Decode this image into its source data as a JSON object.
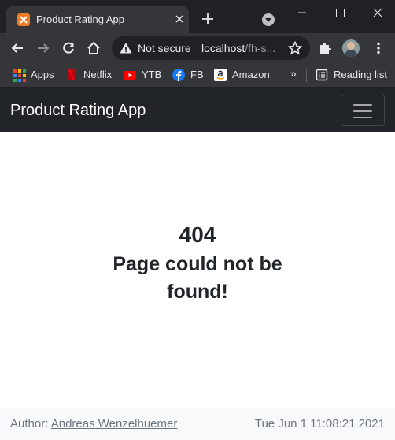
{
  "browser": {
    "tab_title": "Product Rating App",
    "omnibox": {
      "security_label": "Not secure",
      "host": "localhost",
      "path": "/fh-s..."
    },
    "bookmarks": [
      {
        "label": "Apps",
        "icon": "apps-grid-icon"
      },
      {
        "label": "Netflix",
        "icon": "netflix-icon"
      },
      {
        "label": "YTB",
        "icon": "youtube-icon"
      },
      {
        "label": "FB",
        "icon": "facebook-icon"
      },
      {
        "label": "Amazon",
        "icon": "amazon-icon"
      }
    ],
    "bookmarks_overflow": "»",
    "reading_list": "Reading list"
  },
  "navbar": {
    "brand": "Product Rating App"
  },
  "error": {
    "code": "404",
    "message": "Page could not be found!"
  },
  "footer": {
    "author_prefix": "Author:",
    "author_name": "Andreas Wenzelhuemer",
    "date": "Tue Jun 1 11:08:21 2021"
  },
  "colors": {
    "navbar_bg": "#212529",
    "footer_bg": "#f8f9fa",
    "text": "#212529",
    "muted": "#6c757d"
  }
}
